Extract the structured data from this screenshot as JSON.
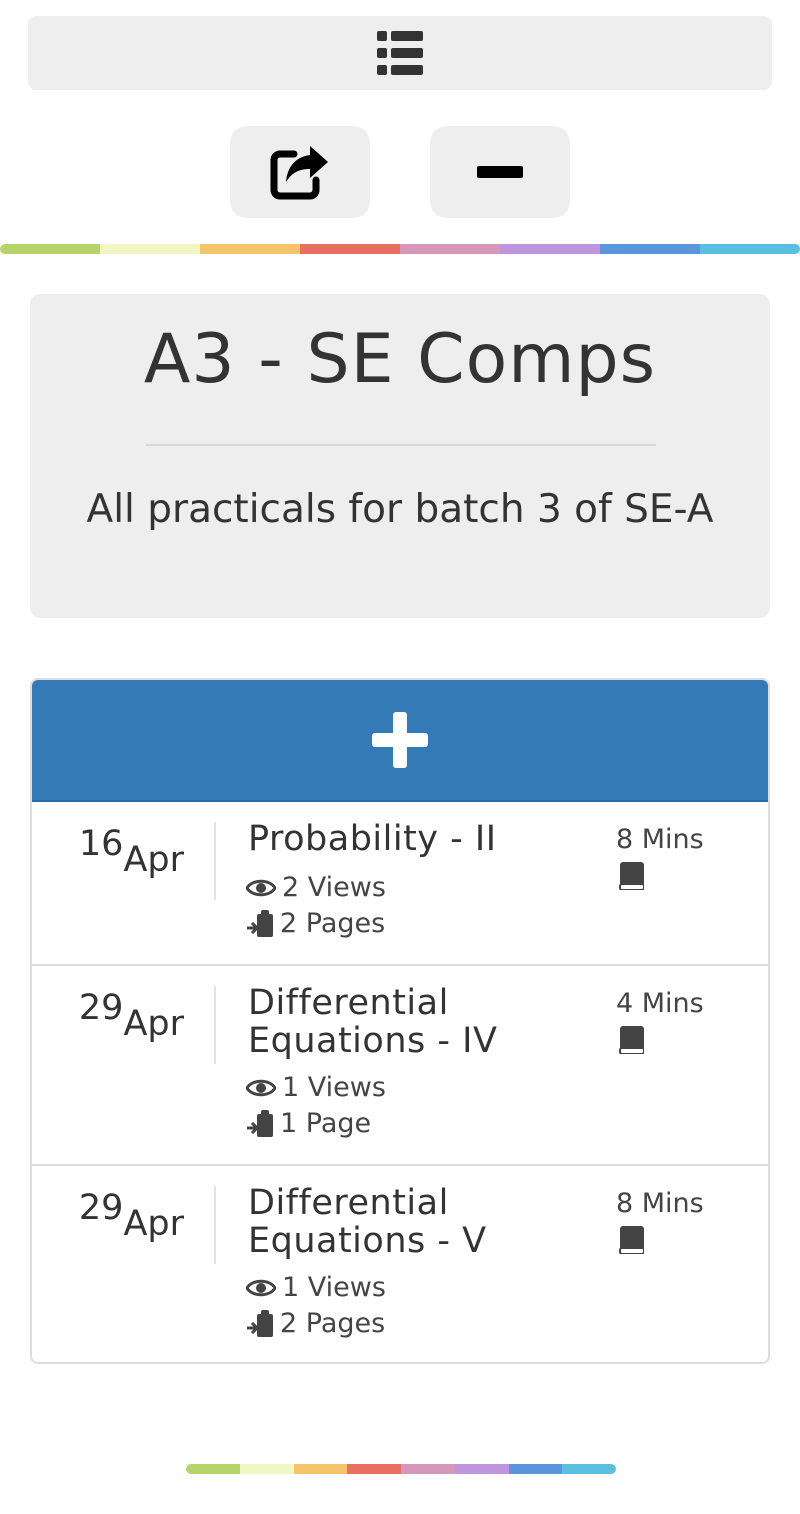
{
  "toolbar": {
    "menu_icon": "list-icon",
    "share_icon": "share-icon",
    "remove_icon": "minus-icon"
  },
  "rainbow_colors": [
    "#b5d56a",
    "#f0f7c4",
    "#f6c46a",
    "#ea6f63",
    "#d598bb",
    "#bf95de",
    "#5b95db",
    "#5bbfe2"
  ],
  "board": {
    "title": "A3 - SE Comps",
    "description": "All practicals for batch 3 of SE-A"
  },
  "add_button": {
    "icon": "plus-icon"
  },
  "entries": [
    {
      "day": "16",
      "month": "Apr",
      "title": "Probability - II",
      "views": "2 Views",
      "pages": "2 Pages",
      "duration": "8 Mins"
    },
    {
      "day": "29",
      "month": "Apr",
      "title": "Differential Equations - IV",
      "views": "1 Views",
      "pages": "1 Page",
      "duration": "4 Mins"
    },
    {
      "day": "29",
      "month": "Apr",
      "title": "Differential Equations - V",
      "views": "1 Views",
      "pages": "2 Pages",
      "duration": "8 Mins"
    }
  ]
}
